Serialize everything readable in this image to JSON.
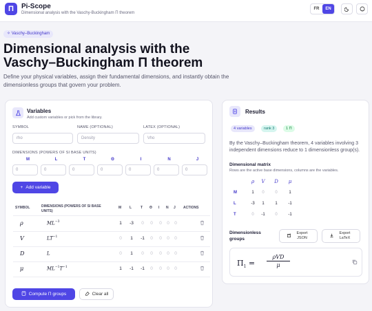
{
  "header": {
    "app_name": "Pi-Scope",
    "subtitle": "Dimensional analysis with the Vaschy-Buckingham Π theorem",
    "languages": [
      "FR",
      "EN"
    ],
    "active_language": "EN"
  },
  "hero": {
    "badge": "Vaschy–Buckingham",
    "title": "Dimensional analysis with the Vaschy–Buckingham Π theorem",
    "description": "Define your physical variables, assign their fundamental dimensions, and instantly obtain the dimensionless groups that govern your problem."
  },
  "variables_card": {
    "title": "Variables",
    "subtitle": "Add custom variables or pick from the library.",
    "symbol_label": "SYMBOL",
    "symbol_placeholder": "rho",
    "name_label": "NAME (OPTIONAL)",
    "name_placeholder": "Density",
    "latex_label": "LATEX (OPTIONAL)",
    "latex_placeholder": "\\rho",
    "dims_label": "DIMENSIONS (POWERS OF SI BASE UNITS)",
    "dim_names": [
      "M",
      "L",
      "T",
      "Θ",
      "I",
      "N",
      "J"
    ],
    "dim_values": [
      "0",
      "0",
      "0",
      "0",
      "0",
      "0",
      "0"
    ],
    "add_button": "Add variable",
    "compute_button": "Compute Π groups",
    "clear_button": "Clear all"
  },
  "variables_table": {
    "headers": {
      "symbol": "SYMBOL",
      "dimensions": "DIMENSIONS (POWERS OF SI BASE UNITS)",
      "cols": [
        "M",
        "L",
        "T",
        "Θ",
        "I",
        "N",
        "J"
      ],
      "actions": "ACTIONS"
    },
    "rows": [
      {
        "symbol": "ρ",
        "dim_base": "ML",
        "dim_exp": "−3",
        "dim_tail": "",
        "dim_tail_exp": "",
        "powers": [
          "1",
          "-3",
          "0",
          "0",
          "0",
          "0",
          "0"
        ]
      },
      {
        "symbol": "V",
        "dim_base": "LT",
        "dim_exp": "−1",
        "dim_tail": "",
        "dim_tail_exp": "",
        "powers": [
          "0",
          "1",
          "-1",
          "0",
          "0",
          "0",
          "0"
        ]
      },
      {
        "symbol": "D",
        "dim_base": "L",
        "dim_exp": "",
        "dim_tail": "",
        "dim_tail_exp": "",
        "powers": [
          "0",
          "1",
          "0",
          "0",
          "0",
          "0",
          "0"
        ]
      },
      {
        "symbol": "μ",
        "dim_base": "ML",
        "dim_exp": "−1",
        "dim_tail": "T",
        "dim_tail_exp": "−1",
        "powers": [
          "1",
          "-1",
          "-1",
          "0",
          "0",
          "0",
          "0"
        ]
      }
    ]
  },
  "results_card": {
    "title": "Results",
    "pills": [
      "4 variables",
      "rank 3",
      "1 Π"
    ],
    "summary": "By the Vaschy–Buckingham theorem, 4 variables involving 3 independent dimensions reduce to 1 dimensionless group(s).",
    "matrix_title": "Dimensional matrix",
    "matrix_note": "Rows are the active base dimensions, columns are the variables.",
    "matrix_cols": [
      "ρ",
      "V",
      "D",
      "μ"
    ],
    "matrix_rows": [
      {
        "dim": "M",
        "values": [
          "1",
          "0",
          "0",
          "1"
        ]
      },
      {
        "dim": "L",
        "values": [
          "-3",
          "1",
          "1",
          "-1"
        ]
      },
      {
        "dim": "T",
        "values": [
          "0",
          "-1",
          "0",
          "-1"
        ]
      }
    ],
    "groups_title": "Dimensionless groups",
    "export_json": "Export JSON",
    "export_latex": "Export LaTeX",
    "formula": {
      "lhs": "Π",
      "lhs_sub": "1",
      "numerator": "ρVD",
      "denominator": "μ"
    }
  },
  "colors": {
    "accent": "#4f46e5",
    "accent_light": "#e8e7fb",
    "pill_green_bg": "#dcfce7",
    "pill_green_text": "#15803d",
    "pill_teal_bg": "#d5f5ef",
    "pill_teal_text": "#0f766e"
  },
  "icons": [
    "flask-icon",
    "sparkle-icon",
    "plus-icon",
    "trash-icon",
    "calculator-icon",
    "eraser-icon",
    "results-icon",
    "export-icon",
    "download-icon",
    "copy-icon",
    "moon-icon",
    "github-icon"
  ]
}
